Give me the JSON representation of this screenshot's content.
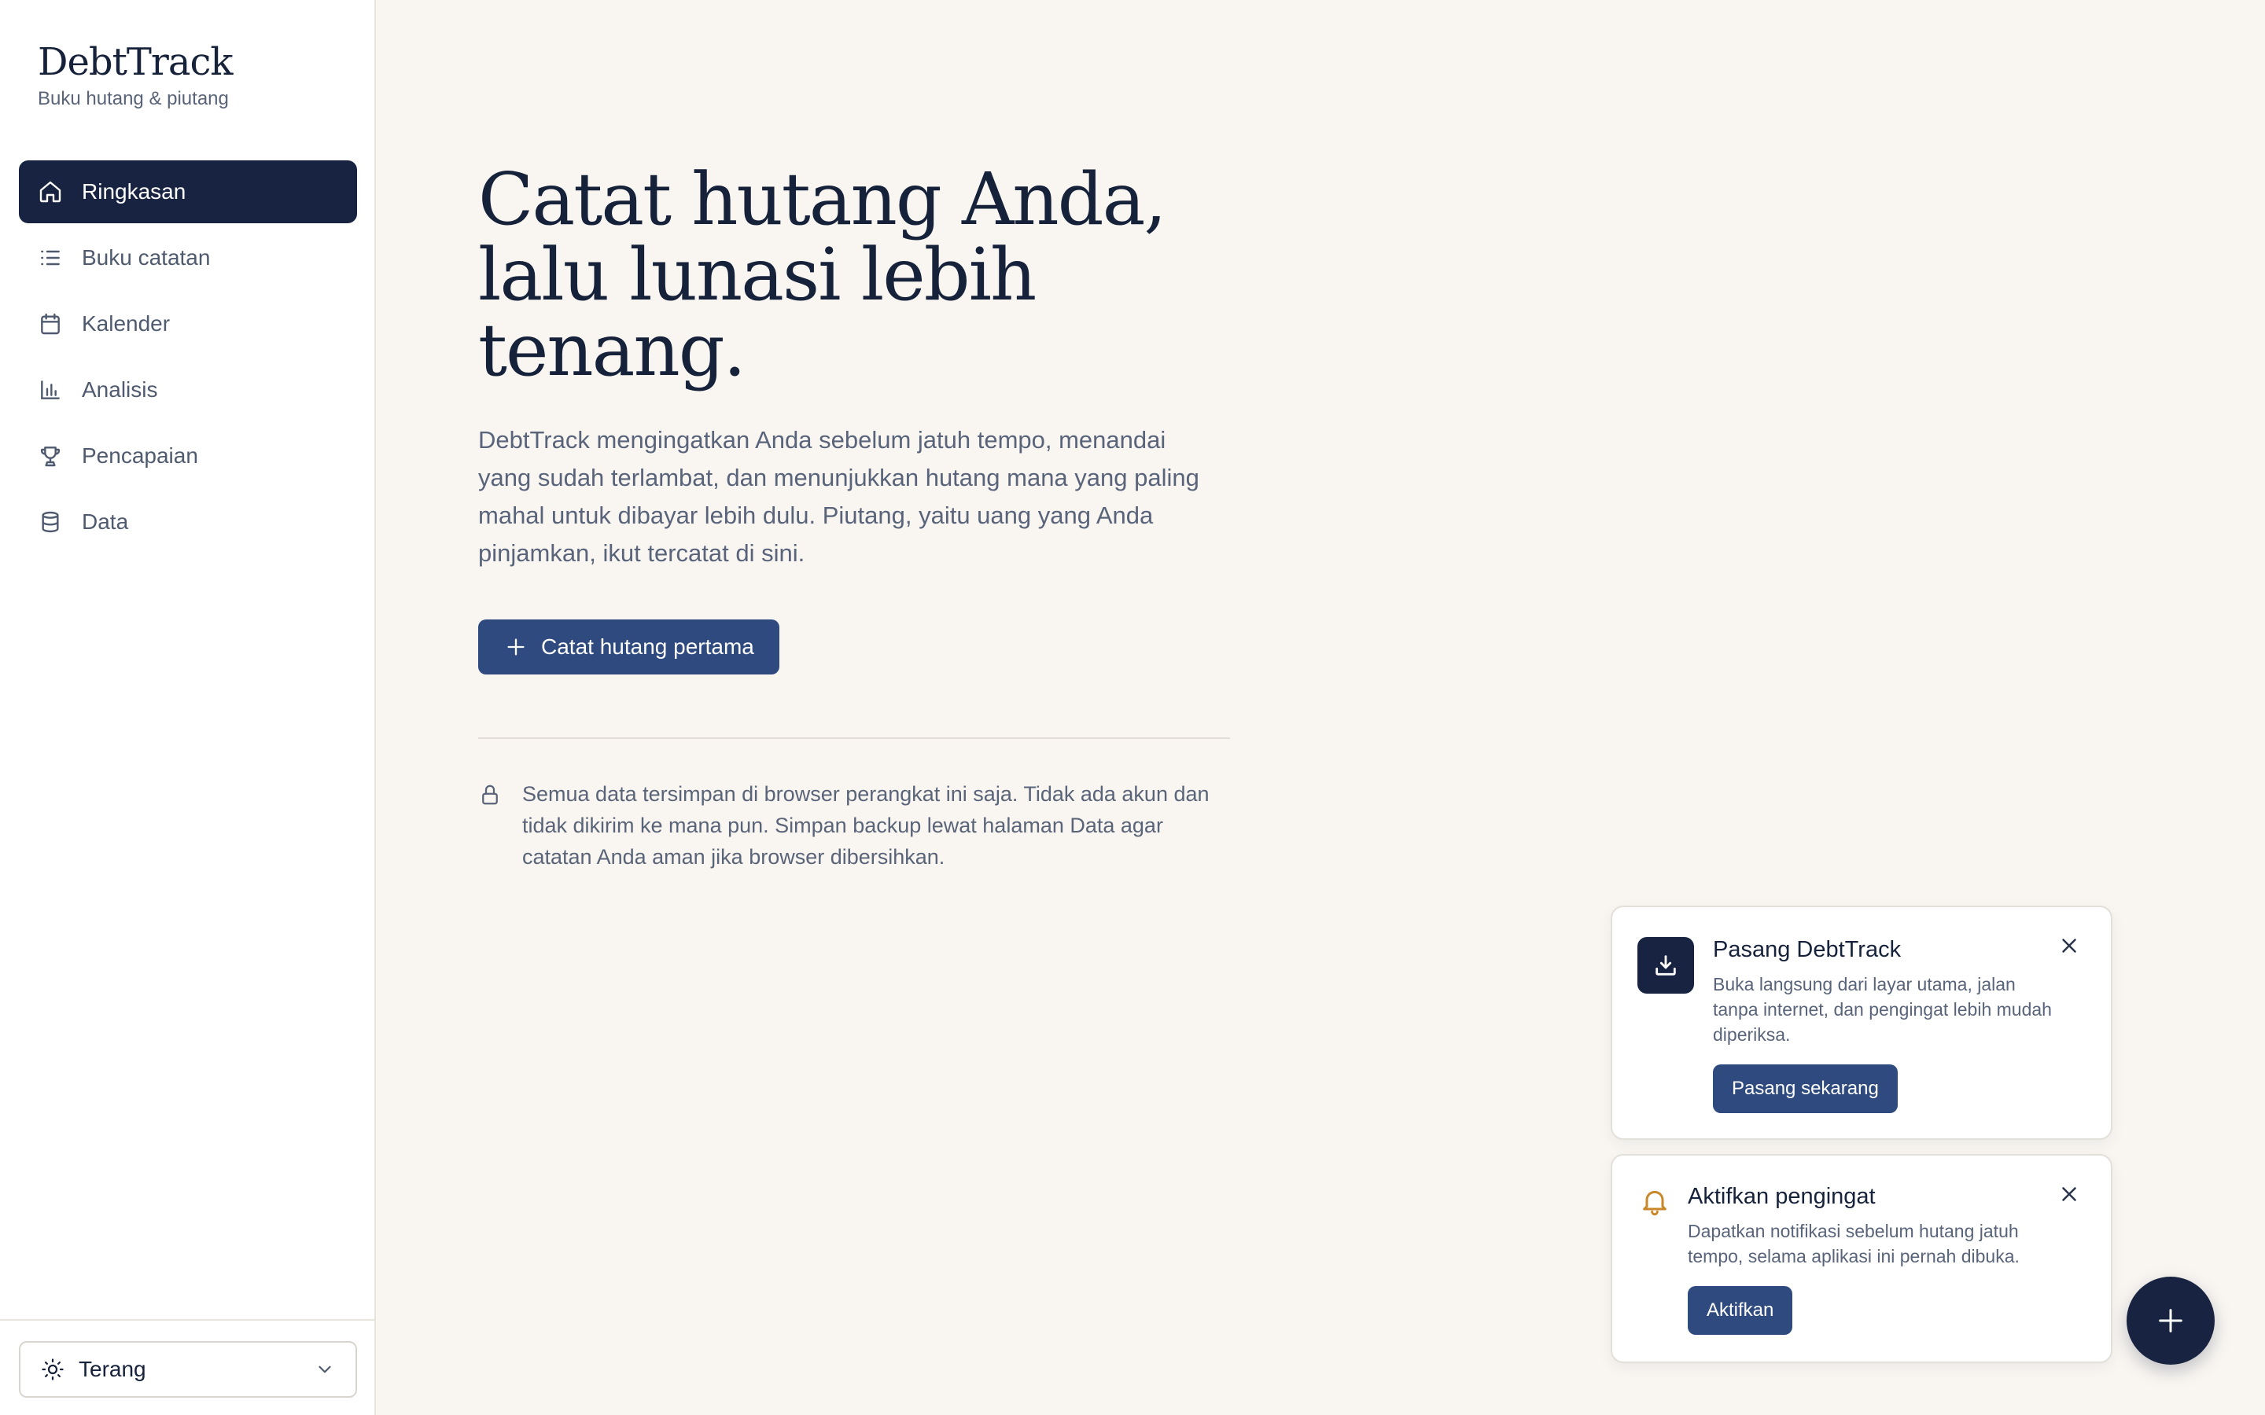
{
  "app": {
    "title": "DebtTrack",
    "subtitle": "Buku hutang & piutang"
  },
  "sidebar": {
    "items": [
      {
        "label": "Ringkasan",
        "icon": "home-icon",
        "active": true
      },
      {
        "label": "Buku catatan",
        "icon": "list-icon"
      },
      {
        "label": "Kalender",
        "icon": "calendar-icon"
      },
      {
        "label": "Analisis",
        "icon": "bar-chart-icon"
      },
      {
        "label": "Pencapaian",
        "icon": "trophy-icon"
      },
      {
        "label": "Data",
        "icon": "database-icon"
      }
    ],
    "theme_select": {
      "value": "Terang",
      "icon": "sun-icon"
    }
  },
  "hero": {
    "title_line1": "Catat hutang Anda,",
    "title_line2": "lalu lunasi lebih",
    "title_line3": "tenang.",
    "description": "DebtTrack mengingatkan Anda sebelum jatuh tempo, menandai yang sudah terlambat, dan menunjukkan hutang mana yang paling mahal untuk dibayar lebih dulu. Piutang, yaitu uang yang Anda pinjamkan, ikut tercatat di sini.",
    "cta_label": "Catat hutang pertama",
    "privacy_note": "Semua data tersimpan di browser perangkat ini saja. Tidak ada akun dan tidak dikirim ke mana pun. Simpan backup lewat halaman Data agar catatan Anda aman jika browser dibersihkan."
  },
  "install_toast": {
    "title": "Pasang DebtTrack",
    "text": "Buka langsung dari layar utama, jalan tanpa internet, dan pengingat lebih mudah diperiksa.",
    "button": "Pasang sekarang"
  },
  "notif_toast": {
    "title": "Aktifkan pengingat",
    "text": "Dapatkan notifikasi sebelum hutang jatuh tempo, selama aplikasi ini pernah dibuka.",
    "button": "Aktifkan"
  },
  "colors": {
    "primary_dark": "#172340",
    "button_blue": "#2e4a7e",
    "background": "#f9f6f2",
    "bell_accent": "#c8882a"
  }
}
